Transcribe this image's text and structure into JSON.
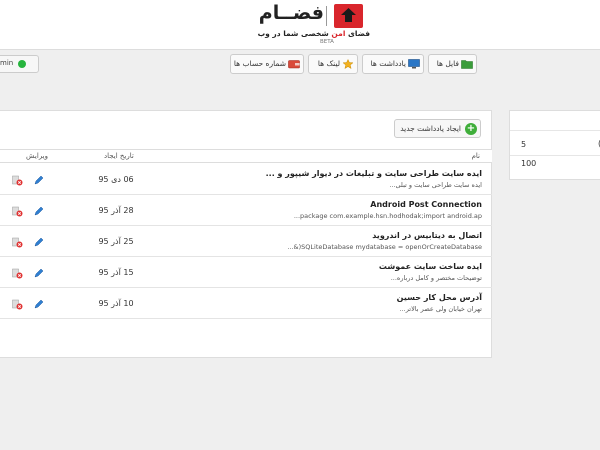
{
  "header": {
    "logo_title": "فضــام",
    "tagline_before": "فضای ",
    "tagline_highlight": "امن",
    "tagline_after": " شخصی شما در وب",
    "beta": "BETA"
  },
  "user": {
    "name": "min",
    "status_color": "#27b43e"
  },
  "nav": [
    {
      "label": "فایل ها",
      "icon": "folder-icon"
    },
    {
      "label": "یادداشت ها",
      "icon": "monitor-icon"
    },
    {
      "label": "لینک ها",
      "icon": "star-icon"
    },
    {
      "label": "شماره حساب ها",
      "icon": "wallet-icon"
    }
  ],
  "side_panel": {
    "value_a": "5",
    "value_b": "100",
    "bracket": "("
  },
  "new_note_label": "ایجاد یادداشت جدید",
  "columns": {
    "name": "نام",
    "created": "تاریخ ایجاد",
    "edit": "ویرایش"
  },
  "rows": [
    {
      "title": "ایده سایت طراحی سایت و تبلیغات در دیوار شیپور و ...",
      "desc": "ایده سایت طراحی سایت و تبلی...",
      "date": "06 دی 95"
    },
    {
      "title": "Android Post Connection",
      "desc": "package com.example.hsn.hodhodak;import android.ap...",
      "date": "28 آذر 95"
    },
    {
      "title": "اتصال به دیتابیس در اندروید",
      "desc": "SQLiteDatabase mydatabase = openOrCreateDatabase(&...",
      "date": "25 آذر 95"
    },
    {
      "title": "ایده ساخت سایت عموشت",
      "desc": "توضیحات مختصر و کامل درباره...",
      "date": "15 آذر 95"
    },
    {
      "title": "آدرس محل کار حسین",
      "desc": "تهران خیابان ولی عصر بالاتر...",
      "date": "10 آذر 95"
    }
  ],
  "colors": {
    "brand": "#d9262c",
    "accent_green": "#3fae3a",
    "delete_red": "#e03131",
    "edit_blue": "#2f7fd1"
  }
}
